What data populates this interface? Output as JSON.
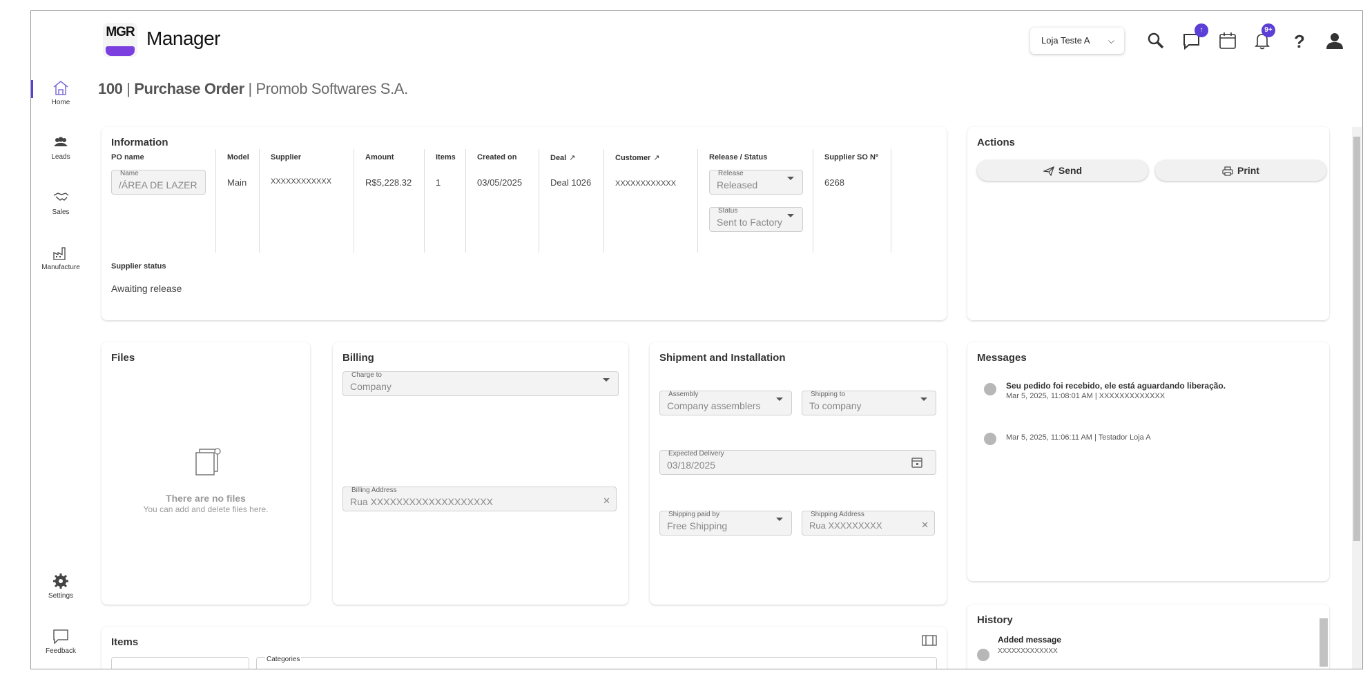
{
  "sidebar": {
    "items": [
      {
        "label": "Home"
      },
      {
        "label": "Leads"
      },
      {
        "label": "Sales"
      },
      {
        "label": "Manufacture"
      },
      {
        "label": "Settings"
      },
      {
        "label": "Feedback"
      }
    ]
  },
  "header": {
    "logo_text": "MGR",
    "app_name": "Manager",
    "store_selector": "Loja Teste A",
    "upload_badge": "↑",
    "notifications_badge": "9+"
  },
  "page": {
    "title_number": "100",
    "title_separator": "|",
    "title_doc": "Purchase Order",
    "title_company": "Promob Softwares S.A."
  },
  "information": {
    "title": "Information",
    "columns": {
      "po_name": "PO name",
      "model": "Model",
      "supplier": "Supplier",
      "amount": "Amount",
      "items": "Items",
      "created_on": "Created on",
      "deal": "Deal",
      "customer": "Customer",
      "release_status": "Release / Status",
      "supplier_so": "Supplier SO Nº"
    },
    "name_label": "Name",
    "name_value": "/ÁREA DE LAZER /",
    "model": "Main",
    "supplier": "XXXXXXXXXXXX",
    "amount": "R$5,228.32",
    "items": "1",
    "created_on": "03/05/2025",
    "deal": "Deal 1026",
    "customer": "XXXXXXXXXXXX",
    "release_label": "Release",
    "release_value": "Released",
    "status_label": "Status",
    "status_value": "Sent to Factory",
    "supplier_so": "6268",
    "supplier_status_label": "Supplier status",
    "supplier_status_value": "Awaiting release"
  },
  "actions": {
    "title": "Actions",
    "send": "Send",
    "print": "Print"
  },
  "files": {
    "title": "Files",
    "empty_title": "There are no files",
    "empty_sub": "You can add and delete files here."
  },
  "billing": {
    "title": "Billing",
    "charge_label": "Charge to",
    "charge_value": "Company",
    "address_label": "Billing Address",
    "address_value": "Rua XXXXXXXXXXXXXXXXXXX"
  },
  "shipment": {
    "title": "Shipment and Installation",
    "assembly_label": "Assembly",
    "assembly_value": "Company assemblers",
    "shipping_to_label": "Shipping to",
    "shipping_to_value": "To company",
    "delivery_label": "Expected Delivery",
    "delivery_value": "03/18/2025",
    "paid_label": "Shipping paid by",
    "paid_value": "Free Shipping",
    "ship_addr_label": "Shipping Address",
    "ship_addr_value": "Rua XXXXXXXXX"
  },
  "messages": {
    "title": "Messages",
    "list": [
      {
        "text": "Seu pedido foi recebido, ele está aguardando liberação.",
        "meta": "Mar 5, 2025, 11:08:01 AM | XXXXXXXXXXXXX"
      },
      {
        "text": "",
        "meta": "Mar 5, 2025, 11:06:11 AM | Testador Loja A"
      }
    ]
  },
  "history": {
    "title": "History",
    "entry_title": "Added message",
    "entry_sub": "XXXXXXXXXXXXX"
  },
  "items_section": {
    "title": "Items",
    "categories_label": "Categories"
  },
  "colors": {
    "accent": "#5b3fd6",
    "logo_purple": "#7b3fe0"
  }
}
